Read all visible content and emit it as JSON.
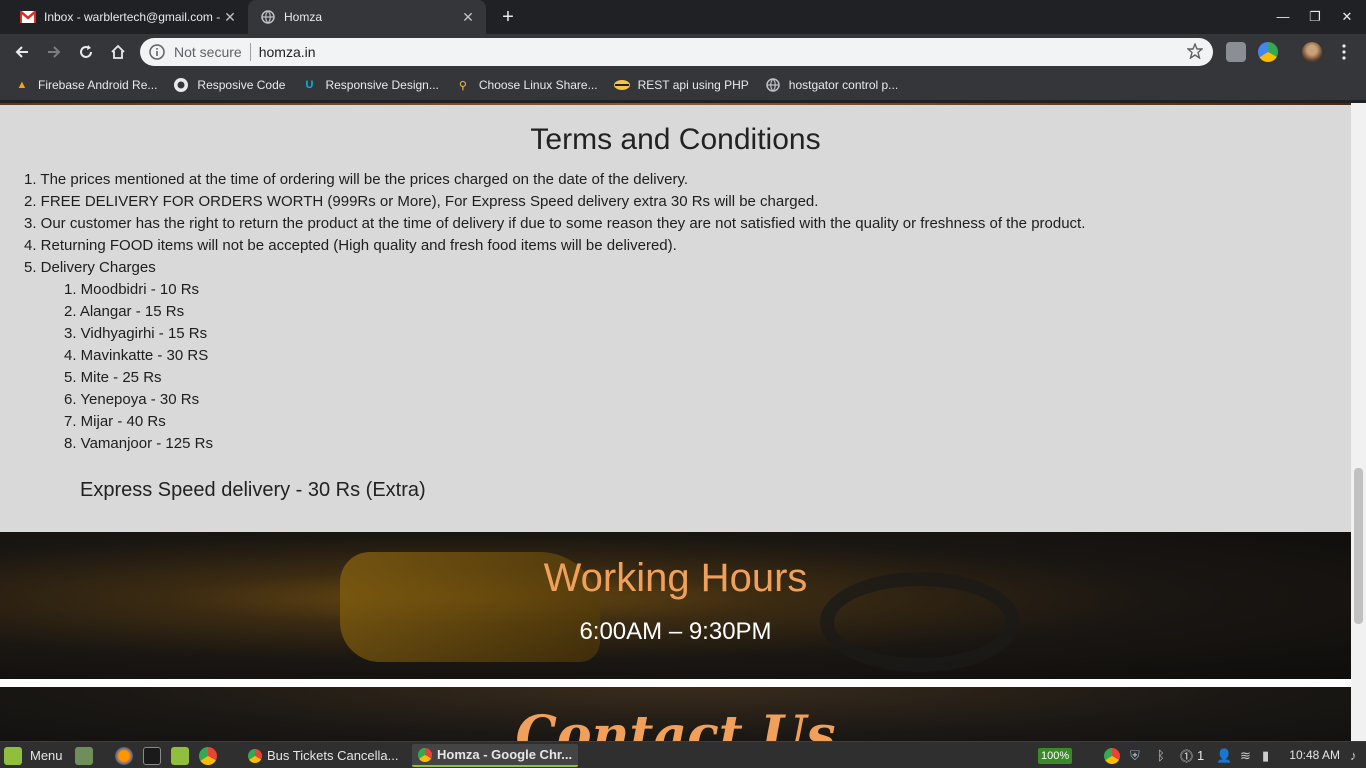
{
  "browser": {
    "tabs": [
      {
        "title": "Inbox - warblertech@gmail.com -",
        "favicon": "gmail-icon",
        "active": false
      },
      {
        "title": "Homza",
        "favicon": "globe-icon",
        "active": true
      }
    ],
    "new_tab": "+",
    "window_controls": {
      "minimize": "—",
      "maximize": "❐",
      "close": "✕"
    },
    "address": {
      "security_label": "Not secure",
      "url": "homza.in"
    },
    "bookmarks": [
      {
        "label": "Firebase Android Re...",
        "icon": "firebase-icon"
      },
      {
        "label": "Resposive Code",
        "icon": "github-icon"
      },
      {
        "label": "Responsive Design...",
        "icon": "udacity-icon"
      },
      {
        "label": "Choose Linux Share...",
        "icon": "linux-icon"
      },
      {
        "label": "REST api using PHP",
        "icon": "api-icon"
      },
      {
        "label": "hostgator control p...",
        "icon": "globe-icon"
      }
    ]
  },
  "page": {
    "terms_title": "Terms and Conditions",
    "terms": [
      "1. The prices mentioned at the time of ordering will be the prices charged on the date of the delivery.",
      "2. FREE DELIVERY FOR ORDERS WORTH (999Rs or More), For Express Speed delivery extra 30 Rs will be charged.",
      "3. Our customer has the right to return the product at the time of delivery if due to some reason they are not satisfied with the quality or freshness of the product.",
      "4. Returning FOOD items will not be accepted (High quality and fresh food items will be delivered).",
      "5. Delivery Charges"
    ],
    "delivery_charges": [
      "1. Moodbidri - 10 Rs",
      "2. Alangar - 15 Rs",
      "3. Vidhyagirhi - 15 Rs",
      "4. Mavinkatte - 30 RS",
      "5. Mite - 25 Rs",
      "6. Yenepoya - 30 Rs",
      "7. Mijar - 40 Rs",
      "8. Vamanjoor - 125 Rs"
    ],
    "express": "Express Speed delivery - 30 Rs (Extra)",
    "hours_title": "Working Hours",
    "hours_time": "6:00AM – 9:30PM",
    "contact_title": "Contact Us"
  },
  "taskbar": {
    "menu_label": "Menu",
    "windows": [
      {
        "label": "Bus Tickets Cancella...",
        "active": false
      },
      {
        "label": "Homza - Google Chr...",
        "active": true
      }
    ],
    "battery": "100%",
    "notifications": "1",
    "clock": "10:48 AM"
  },
  "colors": {
    "accent": "#f0a05a",
    "terms_bg": "#d9d9d9",
    "chrome_dark": "#202124"
  }
}
